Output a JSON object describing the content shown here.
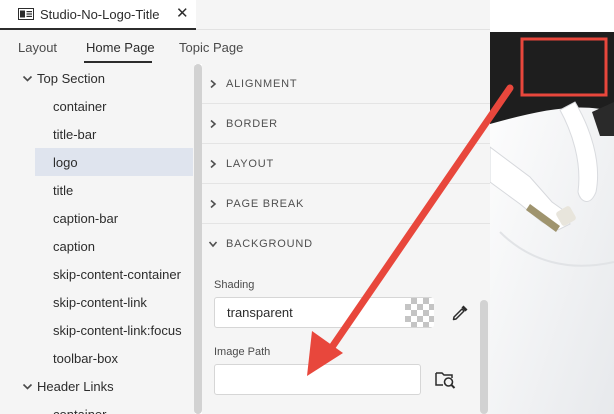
{
  "document_tab": {
    "icon": "document-layout-icon",
    "title": "Studio-No-Logo-Title",
    "close_label": "✕"
  },
  "sub_tabs": [
    {
      "label": "Layout",
      "active": false
    },
    {
      "label": "Home Page",
      "active": true
    },
    {
      "label": "Topic Page",
      "active": false
    }
  ],
  "tree": {
    "groups": [
      {
        "label": "Top Section",
        "expanded": true,
        "items": [
          {
            "label": "container",
            "selected": false
          },
          {
            "label": "title-bar",
            "selected": false
          },
          {
            "label": "logo",
            "selected": true
          },
          {
            "label": "title",
            "selected": false
          },
          {
            "label": "caption-bar",
            "selected": false
          },
          {
            "label": "caption",
            "selected": false
          },
          {
            "label": "skip-content-container",
            "selected": false
          },
          {
            "label": "skip-content-link",
            "selected": false
          },
          {
            "label": "skip-content-link:focus",
            "selected": false
          },
          {
            "label": "toolbar-box",
            "selected": false
          }
        ]
      },
      {
        "label": "Header Links",
        "expanded": true,
        "items": [
          {
            "label": "container",
            "selected": false
          }
        ]
      }
    ]
  },
  "properties": {
    "sections": [
      {
        "label": "ALIGNMENT",
        "expanded": false
      },
      {
        "label": "BORDER",
        "expanded": false
      },
      {
        "label": "LAYOUT",
        "expanded": false
      },
      {
        "label": "PAGE BREAK",
        "expanded": false
      },
      {
        "label": "BACKGROUND",
        "expanded": true
      }
    ],
    "shading": {
      "label": "Shading",
      "value": "transparent"
    },
    "image_path": {
      "label": "Image Path",
      "value": ""
    }
  },
  "colors": {
    "accent_selected": "#dfe4ee",
    "annotation_red": "#e8473c",
    "preview_dark": "#1e1e1e"
  }
}
